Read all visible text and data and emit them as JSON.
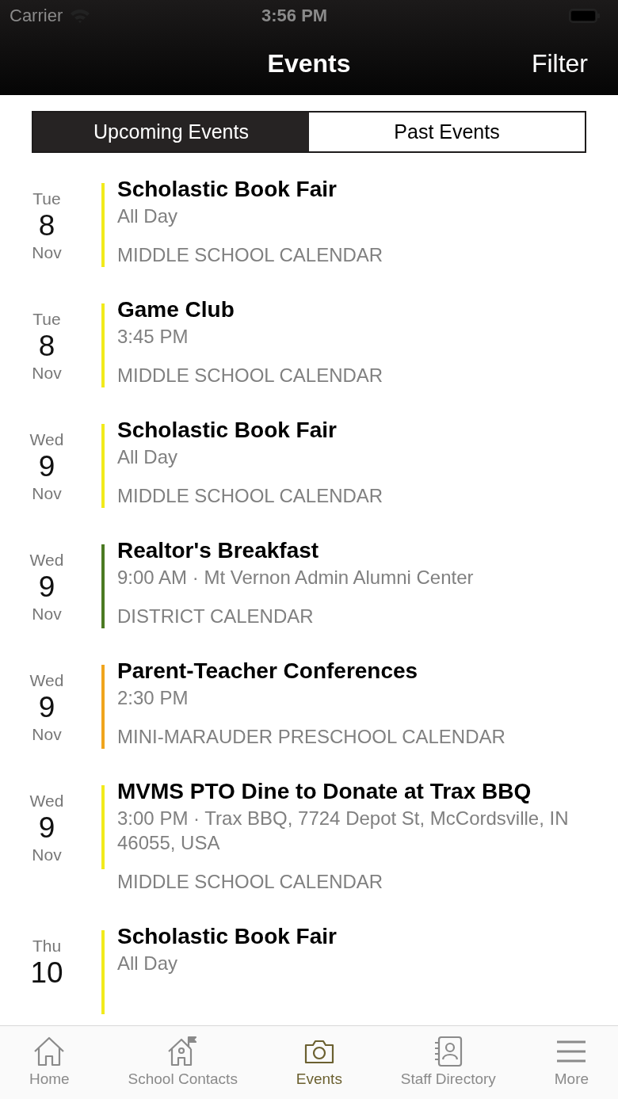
{
  "status_bar": {
    "carrier": "Carrier",
    "time": "3:56 PM"
  },
  "nav": {
    "title": "Events",
    "action": "Filter"
  },
  "segments": [
    {
      "label": "Upcoming Events",
      "selected": true
    },
    {
      "label": "Past Events",
      "selected": false
    }
  ],
  "events": [
    {
      "weekday": "Tue",
      "day": "8",
      "month": "Nov",
      "title": "Scholastic Book Fair",
      "when": "All Day",
      "calendar": "MIDDLE SCHOOL CALENDAR",
      "color": "#f2ea1c"
    },
    {
      "weekday": "Tue",
      "day": "8",
      "month": "Nov",
      "title": "Game Club",
      "when": "3:45 PM",
      "calendar": "MIDDLE SCHOOL CALENDAR",
      "color": "#f2ea1c"
    },
    {
      "weekday": "Wed",
      "day": "9",
      "month": "Nov",
      "title": "Scholastic Book Fair",
      "when": "All Day",
      "calendar": "MIDDLE SCHOOL CALENDAR",
      "color": "#f2ea1c"
    },
    {
      "weekday": "Wed",
      "day": "9",
      "month": "Nov",
      "title": "Realtor's Breakfast",
      "when": "9:00 AM · Mt Vernon Admin Alumni Center",
      "calendar": "DISTRICT CALENDAR",
      "color": "#4b7a22"
    },
    {
      "weekday": "Wed",
      "day": "9",
      "month": "Nov",
      "title": "Parent-Teacher Conferences",
      "when": "2:30 PM",
      "calendar": "MINI-MARAUDER PRESCHOOL CALENDAR",
      "color": "#f0a51e"
    },
    {
      "weekday": "Wed",
      "day": "9",
      "month": "Nov",
      "title": "MVMS PTO Dine to Donate at Trax BBQ",
      "when": "3:00 PM · Trax BBQ, 7724 Depot St, McCordsville, IN 46055, USA",
      "calendar": "MIDDLE SCHOOL CALENDAR",
      "color": "#f2ea1c"
    },
    {
      "weekday": "Thu",
      "day": "10",
      "title": "Scholastic Book Fair",
      "when": "All Day",
      "color": "#f2ea1c"
    }
  ],
  "tab_bar": [
    {
      "label": "Home",
      "kind": "home",
      "selected": false
    },
    {
      "label": "School Contacts",
      "kind": "school",
      "selected": false
    },
    {
      "label": "Events",
      "kind": "camera",
      "selected": true
    },
    {
      "label": "Staff Directory",
      "kind": "contacts",
      "selected": false
    },
    {
      "label": "More",
      "kind": "menu",
      "selected": false
    }
  ]
}
